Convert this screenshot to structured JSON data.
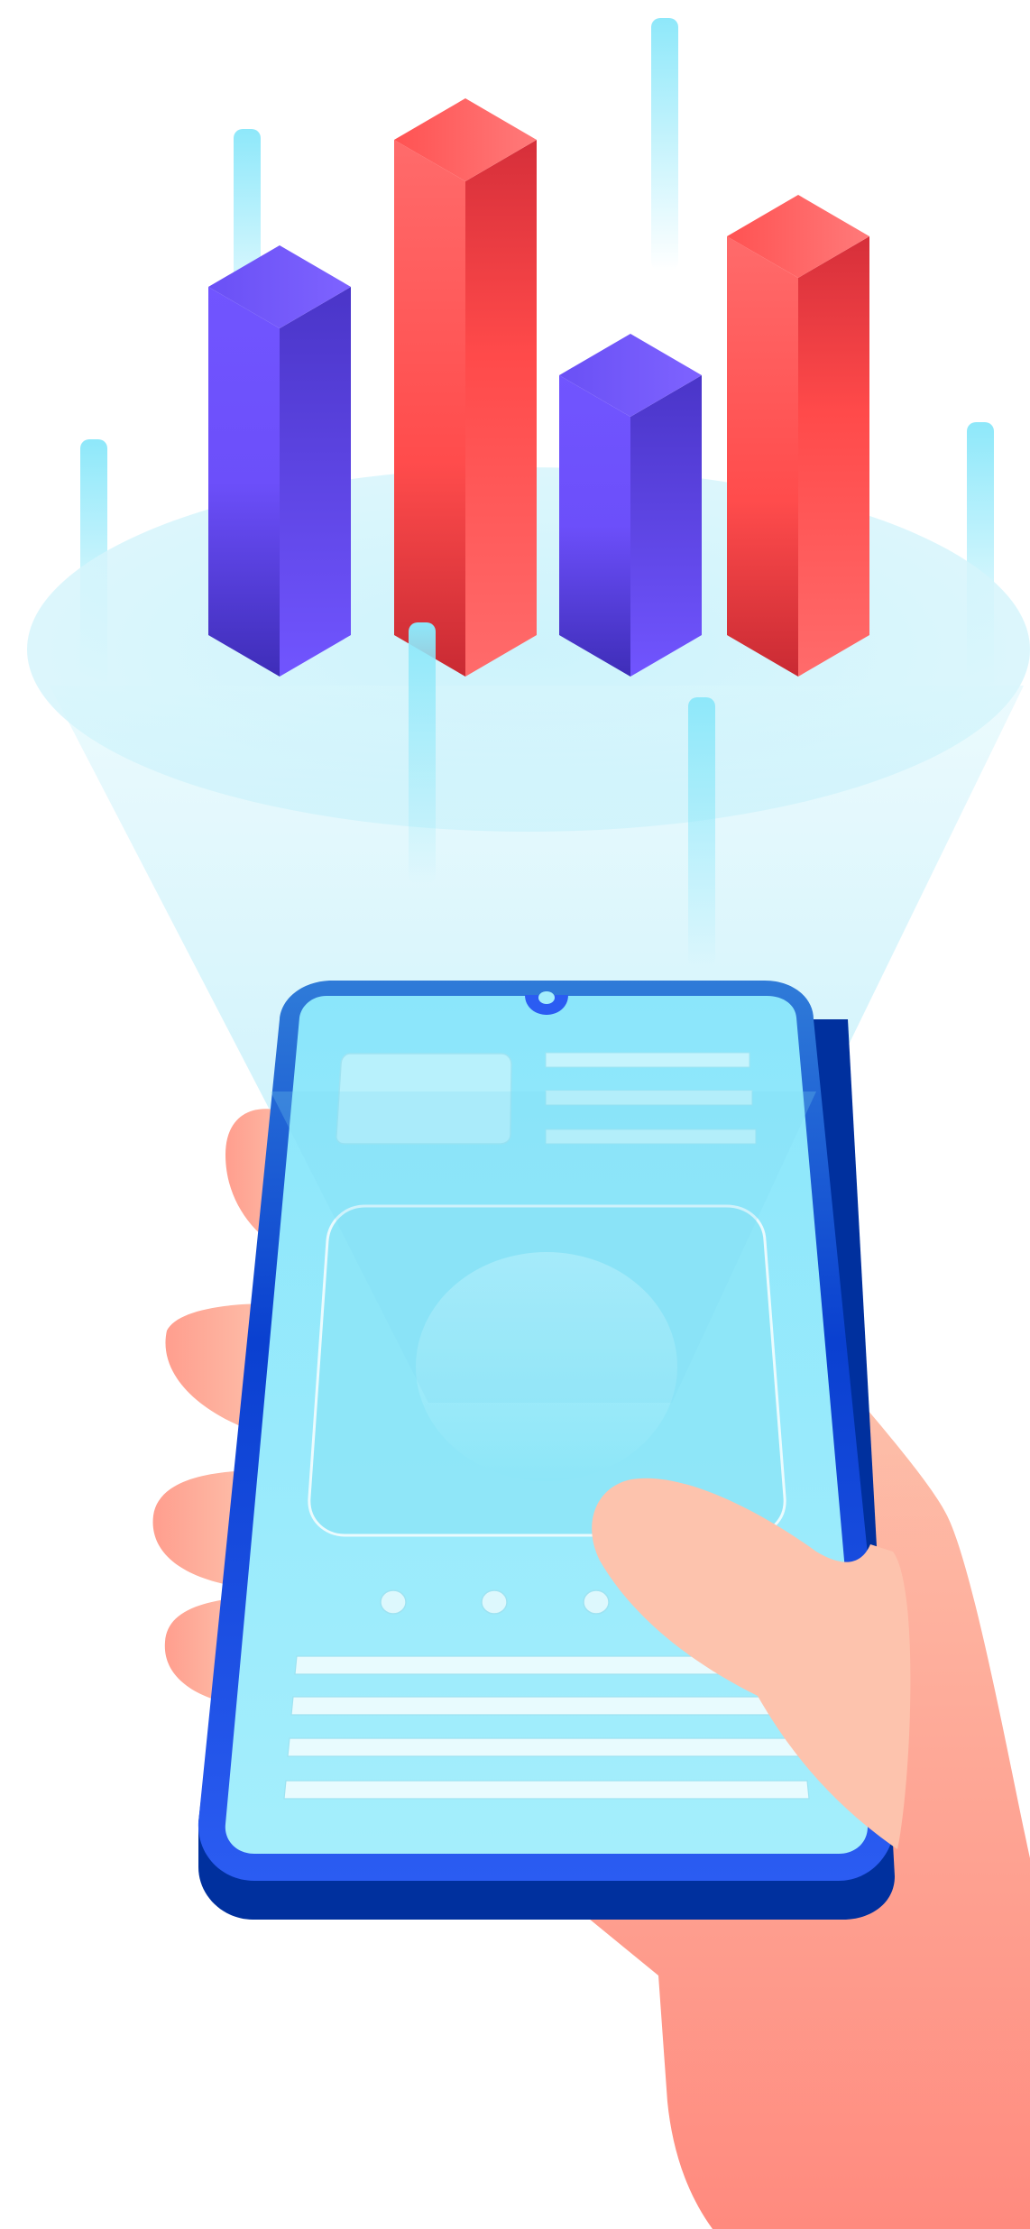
{
  "illustration": {
    "subject": "hand-holding-phone-with-3d-bar-chart",
    "bars": [
      {
        "color": "purple",
        "level": 0.62
      },
      {
        "color": "red",
        "level": 0.88
      },
      {
        "color": "purple",
        "level": 0.46
      },
      {
        "color": "red",
        "level": 0.72
      }
    ],
    "palette": {
      "purple_light": "#7155FF",
      "purple_dark": "#3E2DB8",
      "red_light": "#FF6B6B",
      "red_dark": "#D62F3A",
      "cyan_glow": "#BEEFFA",
      "phone_body": "#2B5CF2",
      "phone_body_dark": "#00309E",
      "phone_screen": "#A4EEFC",
      "skin_light": "#FDC3AD",
      "skin_dark": "#FF8A7E"
    },
    "icons": [
      "bar-chart-icon",
      "smartphone-icon",
      "hand-icon"
    ]
  }
}
